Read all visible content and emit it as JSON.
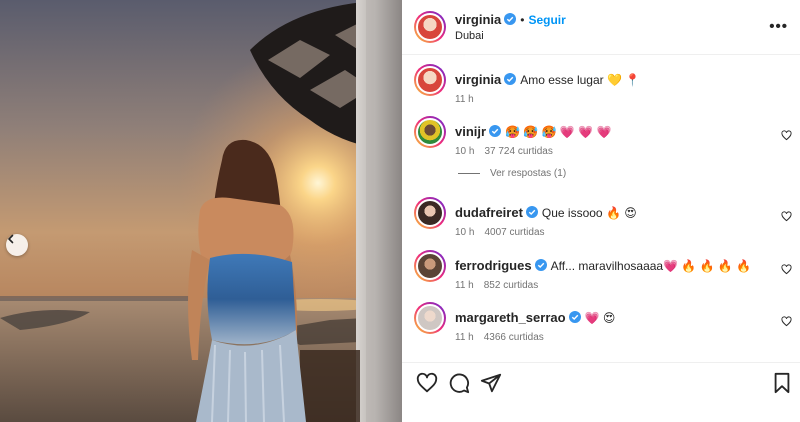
{
  "post": {
    "author": "virginia",
    "follow_label": "Seguir",
    "separator": "•",
    "location": "Dubai",
    "more_label": "•••"
  },
  "comments": [
    {
      "user": "virginia",
      "text": "Amo esse lugar 💛 📍",
      "time": "11 h",
      "likes": ""
    },
    {
      "user": "vinijr",
      "text": "🥵 🥵 🥵 💗 💗 💗",
      "time": "10 h",
      "likes": "37 724 curtidas"
    },
    {
      "user": "dudafreiret",
      "text": "Que issooo 🔥 😍",
      "time": "10 h",
      "likes": "4007 curtidas"
    },
    {
      "user": "ferrodrigues",
      "text": "Aff... maravilhosaaaa💗 🔥 🔥 🔥 🔥",
      "time": "11 h",
      "likes": "852 curtidas"
    },
    {
      "user": "margareth_serrao",
      "text": "💗 😍",
      "time": "11 h",
      "likes": "4366 curtidas"
    }
  ],
  "view_replies_label": "Ver respostas (1)",
  "colors": {
    "follow": "#0095f6",
    "verified": "#3897f0",
    "muted": "#737373"
  },
  "icons": [
    "chevron-left-icon",
    "verified-icon",
    "more-icon",
    "heart-icon",
    "comment-icon",
    "share-icon",
    "bookmark-icon"
  ]
}
